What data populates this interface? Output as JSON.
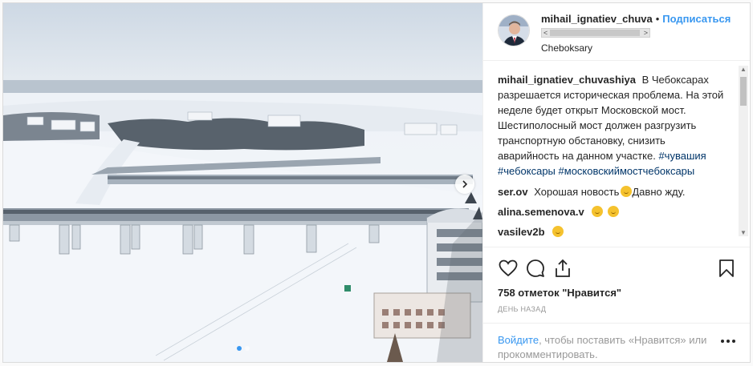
{
  "post": {
    "username": "mihail_ignatiev_chuva",
    "bullet": "•",
    "follow_label": "Подписаться",
    "location": "Cheboksary",
    "scroll_left": "<",
    "scroll_right": ">"
  },
  "caption": {
    "username": "mihail_ignatiev_chuvashiya",
    "text": "В Чебоксарах разрешается историческая проблема. На этой неделе будет открыт Московской мост. Шестиполосный мост должен разгрузить транспортную обстановку, снизить аварийность на данном участке.",
    "hashtags": [
      "#чувашия",
      "#чебоксары",
      "#московскиймостчебоксары"
    ]
  },
  "comments": [
    {
      "username": "ser.ov",
      "text": "Хорошая новость",
      "tail": "Давно жду.",
      "emoji": [
        "ok-hand-emoji"
      ]
    },
    {
      "username": "alina.semenova.v",
      "text": "",
      "tail": "",
      "emoji": [
        "grinning-face-emoji",
        "clapping-hands-emoji"
      ]
    },
    {
      "username": "vasilev2b",
      "text": "",
      "tail": "",
      "emoji": [
        "clapping-hands-emoji"
      ]
    }
  ],
  "likes": "758 отметок \"Нравится\"",
  "date": "ДЕНЬ НАЗАД",
  "login_prompt": {
    "login_link": "Войдите",
    "rest": ", чтобы поставить «Нравится» или прокомментировать."
  },
  "icons": {
    "like": "heart-icon",
    "comment": "comment-icon",
    "share": "share-icon",
    "save": "bookmark-icon",
    "next": "chevron-right-icon",
    "more": "more-options-icon"
  },
  "colors": {
    "link": "#3897f0",
    "hashtag": "#003569",
    "muted": "#999999",
    "text": "#262626"
  }
}
